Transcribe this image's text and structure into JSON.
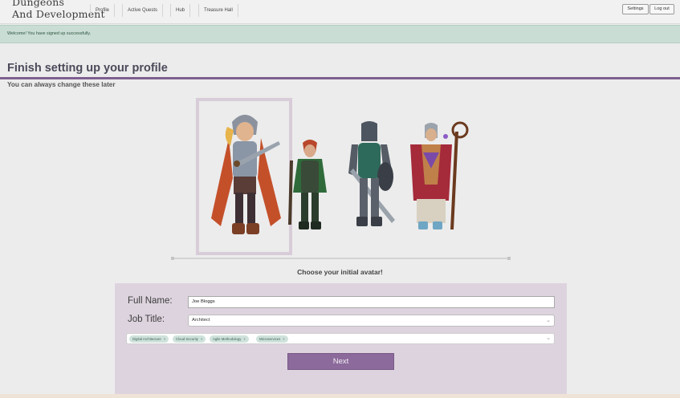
{
  "nav": {
    "brand_line1": "Dungeons",
    "brand_line2": "And Development",
    "links": [
      "Profile",
      "Active Quests",
      "Hub",
      "Treasure Hall"
    ],
    "settings_label": "Settings",
    "logout_label": "Log out"
  },
  "alert": {
    "message": "Welcome! You have signed up successfully."
  },
  "page": {
    "title": "Finish setting up your profile",
    "subtitle": "You can always change these later"
  },
  "avatars": {
    "choose_label": "Choose your initial avatar!",
    "items": [
      "warrior-avatar",
      "ranger-avatar",
      "knight-avatar",
      "mage-avatar"
    ],
    "selected_index": 0
  },
  "form": {
    "full_name_label": "Full Name:",
    "full_name_value": "Joe Bloggs",
    "job_title_label": "Job Title:",
    "job_title_value": "Architect",
    "tags": [
      "Digital Architecture",
      "Cloud Security",
      "Agile Methodology",
      "Microservices"
    ],
    "next_label": "Next"
  },
  "colors": {
    "accent": "#7e5f8f",
    "button": "#8c6a9b",
    "alert_bg": "#c9ddd4",
    "panel_bg": "#ddd3de"
  }
}
